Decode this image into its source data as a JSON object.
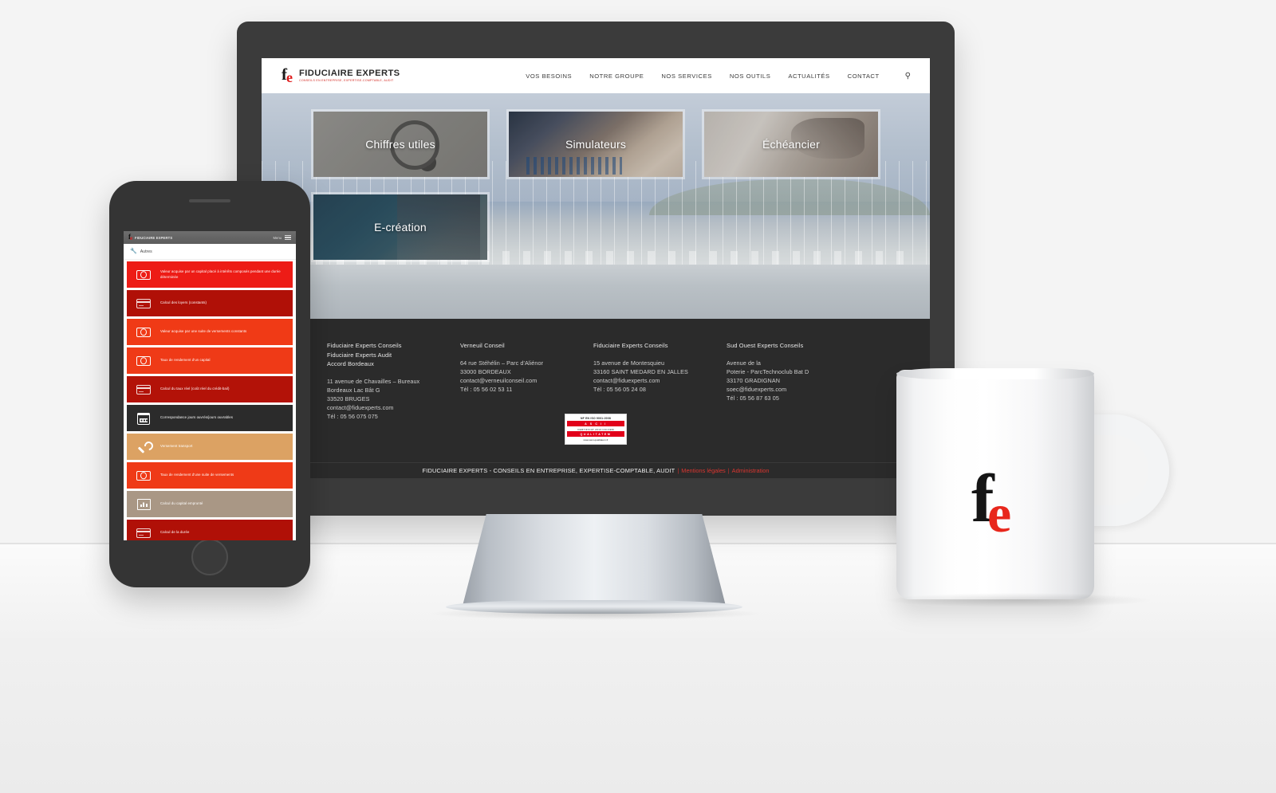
{
  "brand": {
    "logo_f": "f",
    "logo_e": "e",
    "name": "FIDUCIAIRE EXPERTS",
    "tagline": "CONSEILS EN ENTREPRISE, EXPERTISE-COMPTABLE, AUDIT",
    "accent_red": "#e2001a",
    "dark": "#2b2b2b"
  },
  "desktop": {
    "nav": {
      "items": [
        {
          "label": "VOS BESOINS"
        },
        {
          "label": "NOTRE GROUPE"
        },
        {
          "label": "NOS SERVICES"
        },
        {
          "label": "NOS OUTILS"
        },
        {
          "label": "ACTUALITÉS"
        },
        {
          "label": "CONTACT"
        }
      ],
      "search_icon": "search-icon",
      "search_glyph": "⚲"
    },
    "hero": {
      "tiles": [
        {
          "label": "Chiffres utiles",
          "key": "chiffres"
        },
        {
          "label": "Simulateurs",
          "key": "simulateurs"
        },
        {
          "label": "Échéancier",
          "key": "echeancier"
        },
        {
          "label": "E-création",
          "key": "ecreation"
        }
      ]
    },
    "footer": {
      "columns": [
        {
          "titles": [
            "Fiduciaire Experts Conseils",
            "Fiduciaire Experts Audit",
            "Accord Bordeaux"
          ],
          "lines": [
            "11 avenue de Chavailles – Bureaux",
            "Bordeaux Lac Bât G",
            "33520 BRUGES",
            "contact@fiduexperts.com",
            "Tél : 05 56 075 075"
          ]
        },
        {
          "titles": [
            "Verneuil Conseil"
          ],
          "lines": [
            "64 rue Stéhélin – Parc d'Aliénor",
            "33000 BORDEAUX",
            "contact@verneuilconseil.com",
            "Tél : 05 56 02 53 11"
          ]
        },
        {
          "titles": [
            "Fiduciaire Experts Conseils"
          ],
          "lines": [
            "15 avenue de Montesquieu",
            "33160 SAINT MEDARD EN JALLES",
            "contact@fiduexperts.com",
            "Tél : 05 56 05 24 08"
          ]
        },
        {
          "titles": [
            "Sud Ouest Experts Conseils"
          ],
          "lines": [
            "Avenue de la",
            "Poterie - ParcTechnoclub Bat D",
            "33170 GRADIGNAN",
            "soec@fiduexperts.com",
            "Tél : 05 56 87 63 05"
          ]
        }
      ],
      "certificate": {
        "standard": "NF EN ISO 9001:2008",
        "org": "A S C I I",
        "line": "CERTIFICAT   2013   CCLVEM",
        "label": "QUALITATEM",
        "url": "www.asci-qualitatem.fr"
      },
      "copyright": {
        "text": "FIDUCIAIRE EXPERTS - CONSEILS EN ENTREPRISE, EXPERTISE-COMPTABLE, AUDIT",
        "separator": "|",
        "links": [
          "Mentions légales",
          "Administration"
        ]
      }
    }
  },
  "mobile": {
    "header": {
      "brand": "FIDUCIAIRE EXPERTS",
      "menu_label": "Menu",
      "menu_icon": "hamburger-icon"
    },
    "breadcrumb": {
      "icon": "wrench-icon",
      "label": "Autres"
    },
    "rows": [
      {
        "text": "Valeur acquise par un capital placé à intérêts composés pendant une durée déterminée",
        "icon": "money-icon",
        "color": "#ed1c16"
      },
      {
        "text": "Calcul des loyers (constants)",
        "icon": "card-icon",
        "color": "#b01007"
      },
      {
        "text": "Valeur acquise par une suite de versements constants",
        "icon": "money-icon",
        "color": "#f03a16"
      },
      {
        "text": "Taux de rendement d'un capital",
        "icon": "money-icon",
        "color": "#ef3a17"
      },
      {
        "text": "Calcul du taux réel (coût réel du crédit-bail)",
        "icon": "card-icon",
        "color": "#b31208"
      },
      {
        "text": "Correspondance jours ouvrés/jours ouvrables",
        "icon": "calendar-icon",
        "color": "#2b2b2b"
      },
      {
        "text": "Versement transport",
        "icon": "wrench-icon",
        "color": "#dca263"
      },
      {
        "text": "Taux de rendement d'une suite de versements",
        "icon": "money-icon",
        "color": "#ef3a17"
      },
      {
        "text": "Calcul du capital emprunté",
        "icon": "chart-icon",
        "color": "#a99785"
      },
      {
        "text": "Calcul de la durée",
        "icon": "card-icon",
        "color": "#b01007"
      }
    ]
  },
  "mug": {
    "logo_f": "f",
    "logo_e": "e"
  }
}
